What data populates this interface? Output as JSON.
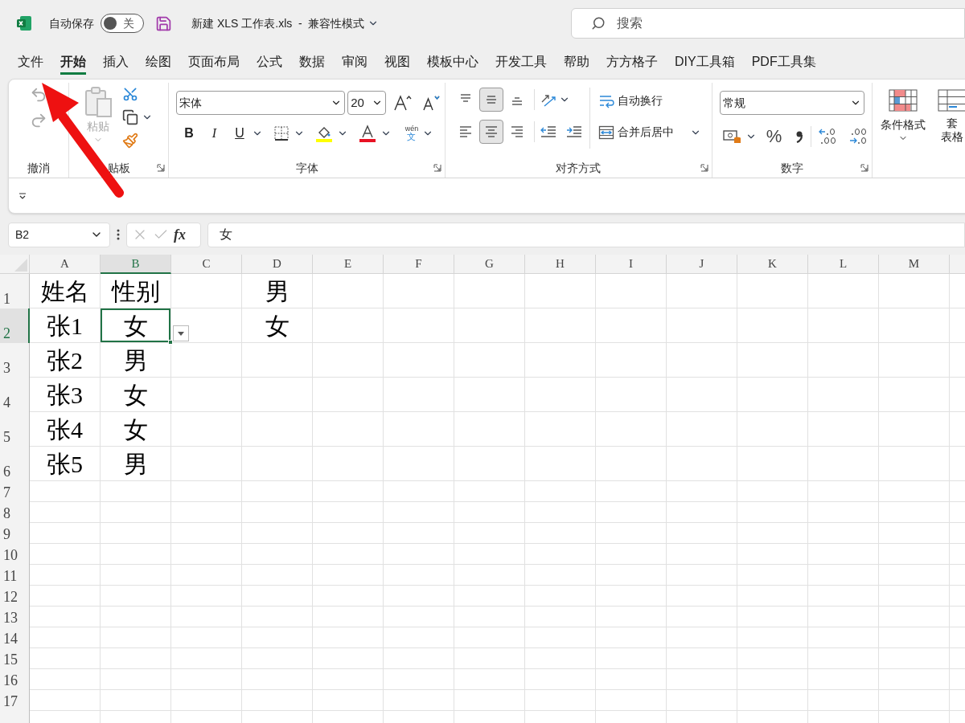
{
  "title_bar": {
    "autosave_label": "自动保存",
    "autosave": {
      "on": false,
      "label": "关"
    },
    "document_title": "新建 XLS 工作表.xls  -  兼容性模式",
    "search": {
      "placeholder": "搜索"
    }
  },
  "tabs": [
    {
      "label": "文件",
      "selected": false
    },
    {
      "label": "开始",
      "selected": true
    },
    {
      "label": "插入",
      "selected": false
    },
    {
      "label": "绘图",
      "selected": false
    },
    {
      "label": "页面布局",
      "selected": false
    },
    {
      "label": "公式",
      "selected": false
    },
    {
      "label": "数据",
      "selected": false
    },
    {
      "label": "审阅",
      "selected": false
    },
    {
      "label": "视图",
      "selected": false
    },
    {
      "label": "模板中心",
      "selected": false
    },
    {
      "label": "开发工具",
      "selected": false
    },
    {
      "label": "帮助",
      "selected": false
    },
    {
      "label": "方方格子",
      "selected": false
    },
    {
      "label": "DIY工具箱",
      "selected": false
    },
    {
      "label": "PDF工具集",
      "selected": false
    }
  ],
  "ribbon": {
    "undo": {
      "label": "撤消"
    },
    "clipboard": {
      "paste": "粘贴",
      "label": "贴板"
    },
    "font": {
      "name": "宋体",
      "size": "20",
      "bold": "B",
      "italic": "I",
      "underline": "U",
      "phonetic": [
        "wén",
        "文"
      ],
      "label": "字体"
    },
    "alignment": {
      "vertical": [
        {
          "kind": "top",
          "selected": false
        },
        {
          "kind": "middle",
          "selected": true
        },
        {
          "kind": "bottom",
          "selected": false
        }
      ],
      "horizontal": [
        {
          "kind": "left",
          "selected": false
        },
        {
          "kind": "center",
          "selected": true
        },
        {
          "kind": "right",
          "selected": false
        }
      ],
      "wrap": "自动换行",
      "merge": "合并后居中",
      "label": "对齐方式"
    },
    "number": {
      "format": "常规",
      "percent": "%",
      "label": "数字"
    },
    "styles": {
      "conditional": "条件格式",
      "table_format": [
        "套",
        "表格"
      ]
    }
  },
  "formula_bar": {
    "name_box": "B2",
    "fx": "fx",
    "value": "女"
  },
  "sheet": {
    "columns": [
      {
        "label": "A",
        "selected": false
      },
      {
        "label": "B",
        "selected": true
      },
      {
        "label": "C",
        "selected": false
      },
      {
        "label": "D",
        "selected": false
      },
      {
        "label": "E",
        "selected": false
      },
      {
        "label": "F",
        "selected": false
      },
      {
        "label": "G",
        "selected": false
      },
      {
        "label": "H",
        "selected": false
      },
      {
        "label": "I",
        "selected": false
      },
      {
        "label": "J",
        "selected": false
      },
      {
        "label": "K",
        "selected": false
      },
      {
        "label": "L",
        "selected": false
      },
      {
        "label": "M",
        "selected": false
      }
    ],
    "rows": [
      {
        "label": "1",
        "selected": false,
        "cells": [
          "姓名",
          "性别",
          null,
          "男"
        ]
      },
      {
        "label": "2",
        "selected": true,
        "cells": [
          "张1",
          "女",
          null,
          "女"
        ]
      },
      {
        "label": "3",
        "selected": false,
        "cells": [
          "张2",
          "男"
        ]
      },
      {
        "label": "4",
        "selected": false,
        "cells": [
          "张3",
          "女"
        ]
      },
      {
        "label": "5",
        "selected": false,
        "cells": [
          "张4",
          "女"
        ]
      },
      {
        "label": "6",
        "selected": false,
        "cells": [
          "张5",
          "男"
        ]
      },
      {
        "label": "7",
        "selected": false
      },
      {
        "label": "8",
        "selected": false
      },
      {
        "label": "9",
        "selected": false
      },
      {
        "label": "10",
        "selected": false
      },
      {
        "label": "11",
        "selected": false
      },
      {
        "label": "12",
        "selected": false
      },
      {
        "label": "13",
        "selected": false
      },
      {
        "label": "14",
        "selected": false
      },
      {
        "label": "15",
        "selected": false
      },
      {
        "label": "16",
        "selected": false
      },
      {
        "label": "17",
        "selected": false
      },
      {
        "selected": false
      }
    ]
  }
}
